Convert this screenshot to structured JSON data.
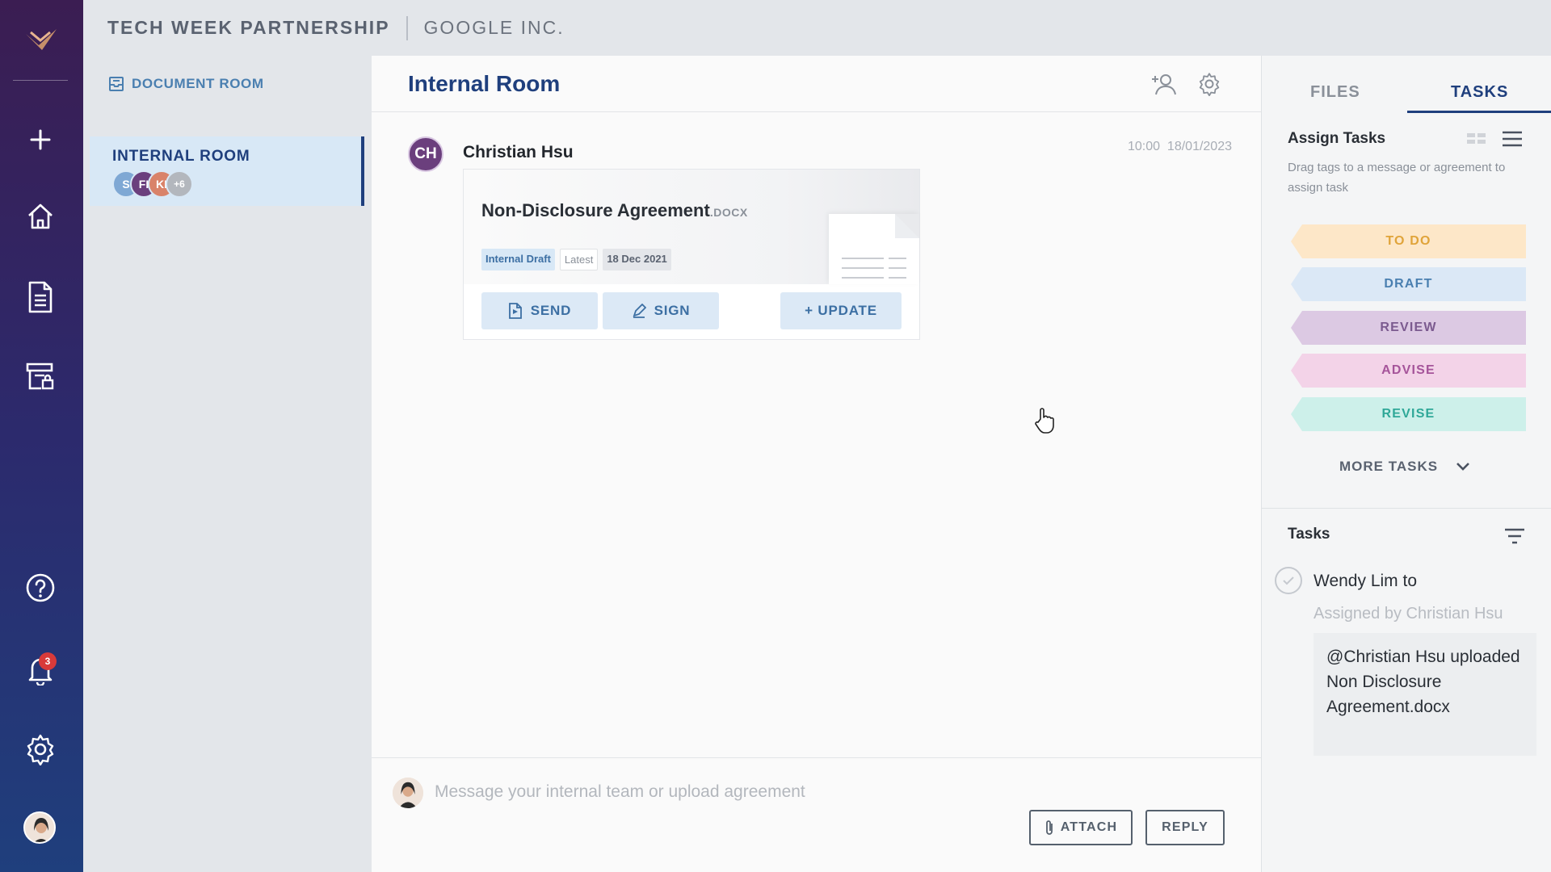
{
  "header": {
    "project": "TECH WEEK PARTNERSHIP",
    "company": "GOOGLE INC."
  },
  "rail": {
    "icons": [
      "logo-icon",
      "plus-icon",
      "home-icon",
      "document-icon",
      "lock-box-icon",
      "help-icon",
      "bell-icon",
      "gear-icon",
      "avatar"
    ],
    "notification_count": "3"
  },
  "rooms": {
    "section_label": "DOCUMENT ROOM",
    "items": [
      {
        "name": "INTERNAL ROOM",
        "members": [
          "S",
          "FI",
          "KI"
        ],
        "extra_members": "+6"
      }
    ]
  },
  "main": {
    "title": "Internal Room",
    "message": {
      "author_initials": "CH",
      "author": "Christian Hsu",
      "time": "10:00",
      "date": "18/01/2023",
      "document": {
        "title": "Non-Disclosure Agreement",
        "extension": ".DOCX",
        "tags": [
          "Internal Draft",
          "Latest",
          "18 Dec 2021"
        ],
        "actions": {
          "send": "SEND",
          "sign": "SIGN",
          "update": "+ UPDATE"
        }
      }
    },
    "composer": {
      "placeholder": "Message your internal team or upload agreement",
      "attach": "ATTACH",
      "reply": "REPLY"
    }
  },
  "right": {
    "tabs": [
      {
        "label": "FILES",
        "active": false
      },
      {
        "label": "TASKS",
        "active": true
      }
    ],
    "assign": {
      "heading": "Assign Tasks",
      "description": "Drag tags to a message or agreement to assign task",
      "tags": [
        {
          "label": "TO DO",
          "bg": "#fde7c8",
          "fg": "#e0a43a"
        },
        {
          "label": "DRAFT",
          "bg": "#dbe8f6",
          "fg": "#4a7fb0"
        },
        {
          "label": "REVIEW",
          "bg": "#dcc9e3",
          "fg": "#7b5a8f"
        },
        {
          "label": "ADVISE",
          "bg": "#f3d3e8",
          "fg": "#a5549a"
        },
        {
          "label": "REVISE",
          "bg": "#cdf0ea",
          "fg": "#2fa898"
        }
      ],
      "more": "MORE TASKS"
    },
    "tasks": {
      "heading": "Tasks",
      "items": [
        {
          "line": "Wendy Lim to",
          "assigned_by": "Assigned by Christian Hsu",
          "body": "@Christian Hsu uploaded Non Disclosure Agreement.docx"
        }
      ]
    }
  },
  "colors": {
    "accent": "#1f3f7d",
    "link": "#4a7fb0",
    "rail_top": "#3b1d52",
    "rail_bottom": "#1f3f7d"
  }
}
